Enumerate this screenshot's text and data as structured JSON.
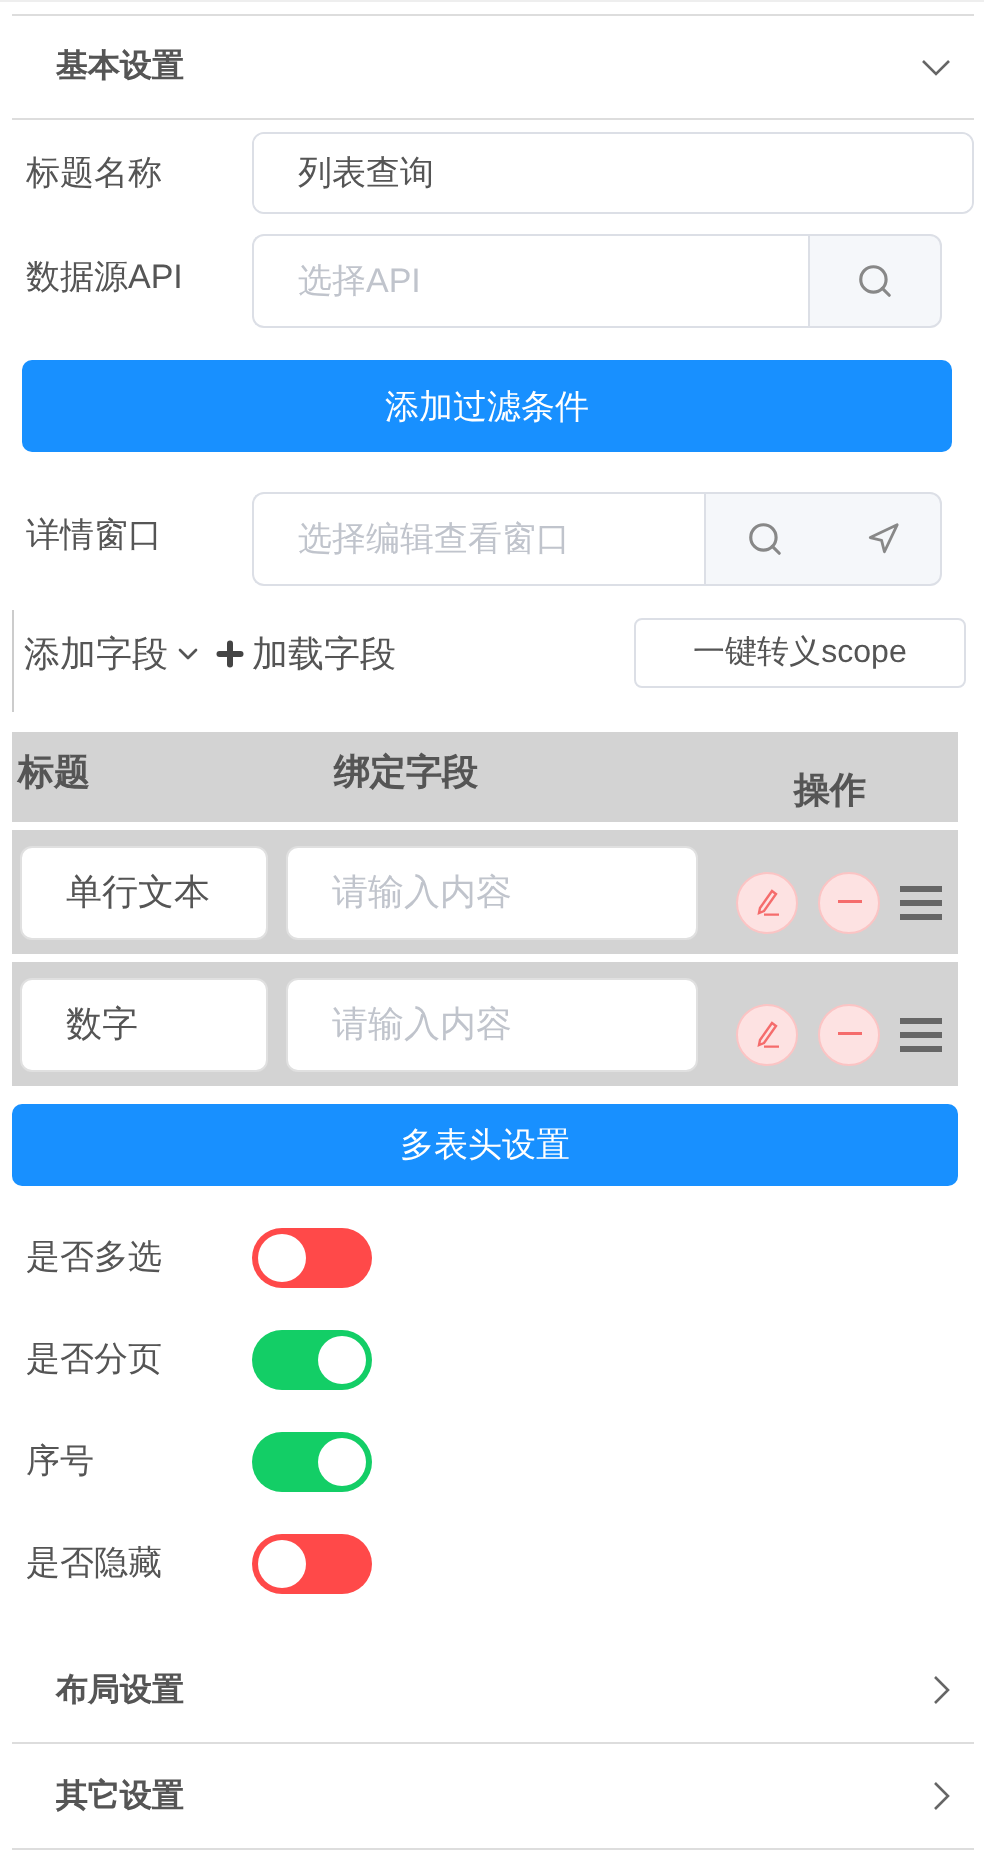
{
  "panels": [
    {
      "title": "基本设置",
      "expanded": true
    },
    {
      "title": "布局设置",
      "expanded": false
    },
    {
      "title": "其它设置",
      "expanded": false
    }
  ],
  "basic": {
    "title_field": {
      "label": "标题名称",
      "value": "列表查询"
    },
    "api_field": {
      "label": "数据源API",
      "placeholder": "选择API"
    },
    "filter_button": "添加过滤条件",
    "detail_field": {
      "label": "详情窗口",
      "placeholder": "选择编辑查看窗口"
    },
    "field_toolbar": {
      "add_field": "添加字段",
      "load_field": "加载字段",
      "scope_button": "一键转义scope"
    },
    "table": {
      "columns": [
        "标题",
        "绑定字段",
        "操作"
      ],
      "rows": [
        {
          "title": "单行文本",
          "placeholder": "请输入内容"
        },
        {
          "title": "数字",
          "placeholder": "请输入内容"
        }
      ]
    },
    "header_button": "多表头设置",
    "toggles": [
      {
        "label": "是否多选",
        "on": false
      },
      {
        "label": "是否分页",
        "on": true
      },
      {
        "label": "序号",
        "on": true
      },
      {
        "label": "是否隐藏",
        "on": false
      }
    ]
  }
}
